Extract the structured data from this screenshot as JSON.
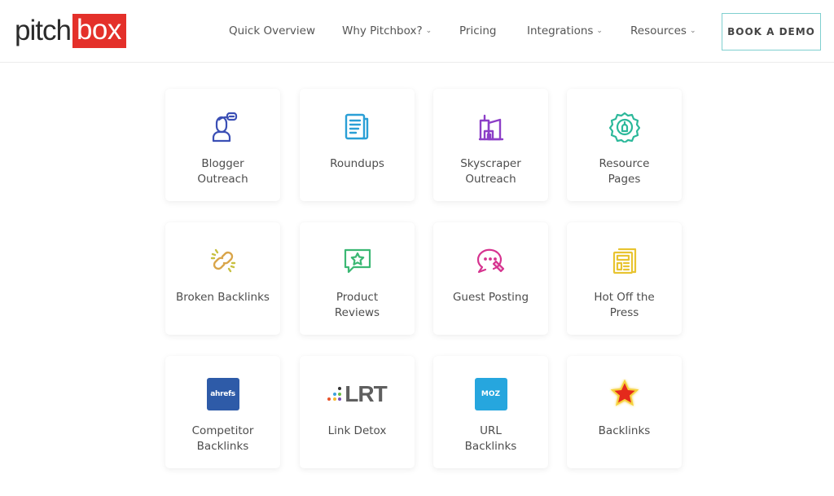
{
  "header": {
    "logo": {
      "part1": "pitch",
      "part2": "box",
      "brand_color": "#e4302a"
    },
    "nav": [
      {
        "label": "Quick Overview",
        "dropdown": false
      },
      {
        "label": "Why Pitchbox?",
        "dropdown": true
      },
      {
        "label": "Pricing",
        "dropdown": false
      },
      {
        "label": "Integrations",
        "dropdown": true
      },
      {
        "label": "Resources",
        "dropdown": true
      }
    ],
    "chevron_glyph": "⌄",
    "cta": {
      "label": "BOOK A DEMO",
      "border_color": "#7fcfcf"
    }
  },
  "cards": [
    {
      "label": "Blogger\nOutreach",
      "icon": "blogger-person-icon",
      "color": "#3b4fb5"
    },
    {
      "label": "Roundups",
      "icon": "newspaper-icon",
      "color": "#2a9fd6"
    },
    {
      "label": "Skyscraper\nOutreach",
      "icon": "buildings-icon",
      "color": "#8c3fc7"
    },
    {
      "label": "Resource\nPages",
      "icon": "badge-icon",
      "color": "#2bb89a"
    },
    {
      "label": "Broken Backlinks",
      "icon": "broken-link-icon",
      "color": "#d9a54a"
    },
    {
      "label": "Product\nReviews",
      "icon": "review-star-bubble-icon",
      "color": "#3bb874"
    },
    {
      "label": "Guest Posting",
      "icon": "chat-pen-icon",
      "color": "#d6338f"
    },
    {
      "label": "Hot Off the\nPress",
      "icon": "press-newspaper-icon",
      "color": "#e8c431"
    },
    {
      "label": "Competitor\nBacklinks",
      "icon": "ahrefs-logo-icon",
      "logo_text": "ahrefs",
      "color": "#2e5ba8"
    },
    {
      "label": "Link Detox",
      "icon": "lrt-logo-icon",
      "logo_text": "LRT",
      "color": "#5f5f5f"
    },
    {
      "label": "URL\nBacklinks",
      "icon": "moz-logo-icon",
      "logo_text": "MOZ",
      "color": "#26a6de"
    },
    {
      "label": "Backlinks",
      "icon": "star-icon",
      "color": "#e42a1f"
    }
  ]
}
